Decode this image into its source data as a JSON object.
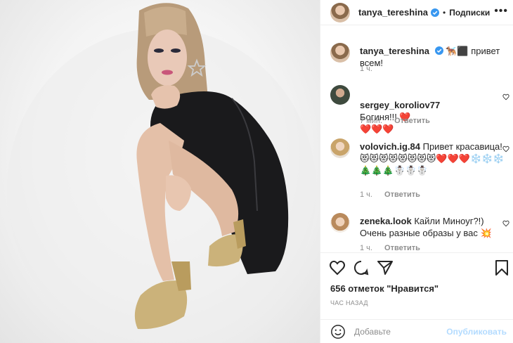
{
  "post": {
    "author": "tanya_tereshina",
    "follow_dot": "•",
    "follow_label": "Подписки",
    "more_label": "•••"
  },
  "caption": {
    "username": "tanya_tereshina",
    "text": "🐕‍🦺⬛ привет всем!",
    "time": "1 ч."
  },
  "comments": [
    {
      "username": "sergey_koroliov77",
      "text": "Богиня!!! ❤️\n❤️❤️❤️",
      "time": "7 мин.",
      "reply": "Ответить"
    },
    {
      "username": "volovich.ig.84",
      "text": "Привет красавица! 😻😻😻😻😻😻😻😻❤️❤️❤️❄️❄️❄️🎄🎄🎄☃️☃️☃️",
      "time": "1 ч.",
      "reply": "Ответить"
    },
    {
      "username": "zeneka.look",
      "text": "Кайли Миноуг?!) Очень разные образы у вас 💥",
      "time": "1 ч.",
      "reply": "Ответить"
    }
  ],
  "likes": "656 отметок \"Нравится\"",
  "posted_ago": "час назад",
  "add_comment": {
    "placeholder": "Добавьте",
    "publish_label": "Опубликовать"
  },
  "colors": {
    "verified": "#3897f0",
    "publish_disabled": "#b3dbff",
    "muted": "#8e8e8e"
  }
}
